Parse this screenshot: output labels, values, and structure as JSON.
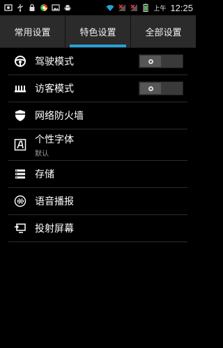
{
  "status_bar": {
    "ampm": "上午",
    "time": "12:25",
    "left_icons": [
      "photo-icon",
      "usb-icon",
      "lock-icon",
      "app-icon",
      "image-icon",
      "android-icon"
    ],
    "right_icons": [
      "wifi-icon",
      "no-signal-icon",
      "no-signal-icon",
      "battery-icon"
    ]
  },
  "tabs": [
    {
      "label": "常用设置",
      "active": false
    },
    {
      "label": "特色设置",
      "active": true
    },
    {
      "label": "全部设置",
      "active": false
    }
  ],
  "settings": [
    {
      "label": "驾驶模式",
      "icon": "steering-wheel-icon",
      "toggle": "off"
    },
    {
      "label": "访客模式",
      "icon": "guest-mode-icon",
      "toggle": "off"
    },
    {
      "label": "网络防火墙",
      "icon": "firewall-shield-icon"
    },
    {
      "label": "个性字体",
      "sub": "默认",
      "icon": "font-icon"
    },
    {
      "label": "存储",
      "icon": "storage-icon"
    },
    {
      "label": "语音播报",
      "icon": "voice-broadcast-icon"
    },
    {
      "label": "投射屏幕",
      "icon": "cast-screen-icon"
    }
  ],
  "colors": {
    "accent": "#2a9fd6",
    "tab_bg": "#2b2b2b",
    "background": "#000000"
  }
}
